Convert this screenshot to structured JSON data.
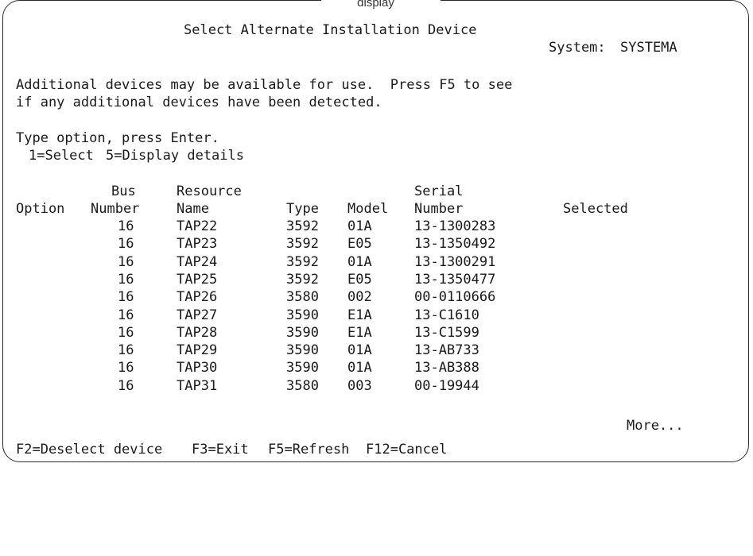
{
  "screen": {
    "caption": "display",
    "title": "Select Alternate Installation Device",
    "system_label": "System:",
    "system_name": "SYSTEMA",
    "message_line1": "Additional devices may be available for use.  Press F5 to see",
    "message_line2": "if any additional devices have been detected.",
    "instruction": "Type option, press Enter.",
    "options": [
      "1=Select",
      "5=Display details"
    ]
  },
  "table": {
    "headers_top": {
      "bus": "Bus",
      "resource": "Resource",
      "serial": "Serial"
    },
    "headers": {
      "option": "Option",
      "bus": "Number",
      "resource": "Name",
      "type": "Type",
      "model": "Model",
      "serial": "Number",
      "selected": "Selected"
    },
    "rows": [
      {
        "option": "",
        "bus": "16",
        "resource": "TAP22",
        "type": "3592",
        "model": "01A",
        "serial": "13-1300283",
        "selected": ""
      },
      {
        "option": "",
        "bus": "16",
        "resource": "TAP23",
        "type": "3592",
        "model": "E05",
        "serial": "13-1350492",
        "selected": ""
      },
      {
        "option": "",
        "bus": "16",
        "resource": "TAP24",
        "type": "3592",
        "model": "01A",
        "serial": "13-1300291",
        "selected": ""
      },
      {
        "option": "",
        "bus": "16",
        "resource": "TAP25",
        "type": "3592",
        "model": "E05",
        "serial": "13-1350477",
        "selected": ""
      },
      {
        "option": "",
        "bus": "16",
        "resource": "TAP26",
        "type": "3580",
        "model": "002",
        "serial": "00-0110666",
        "selected": ""
      },
      {
        "option": "",
        "bus": "16",
        "resource": "TAP27",
        "type": "3590",
        "model": "E1A",
        "serial": "13-C1610",
        "selected": ""
      },
      {
        "option": "",
        "bus": "16",
        "resource": "TAP28",
        "type": "3590",
        "model": "E1A",
        "serial": "13-C1599",
        "selected": ""
      },
      {
        "option": "",
        "bus": "16",
        "resource": "TAP29",
        "type": "3590",
        "model": "01A",
        "serial": "13-AB733",
        "selected": ""
      },
      {
        "option": "",
        "bus": "16",
        "resource": "TAP30",
        "type": "3590",
        "model": "01A",
        "serial": "13-AB388",
        "selected": ""
      },
      {
        "option": "",
        "bus": "16",
        "resource": "TAP31",
        "type": "3580",
        "model": "003",
        "serial": "00-19944",
        "selected": ""
      }
    ],
    "more": "More..."
  },
  "function_keys": [
    {
      "label": "F2=Deselect device"
    },
    {
      "label": "F3=Exit"
    },
    {
      "label": "F5=Refresh"
    },
    {
      "label": "F12=Cancel"
    }
  ]
}
